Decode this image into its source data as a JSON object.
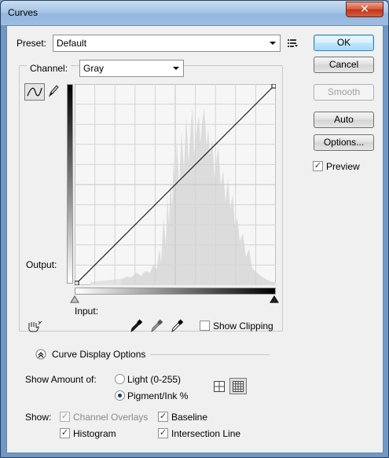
{
  "window": {
    "title": "Curves",
    "close_glyph": "✕"
  },
  "preset": {
    "label": "Preset:",
    "value": "Default",
    "menu_icon": "preset-options-icon"
  },
  "channel": {
    "label": "Channel:",
    "value": "Gray"
  },
  "graph": {
    "output_label": "Output:",
    "input_label": "Input:",
    "curve_tool_icon": "curve-point-icon",
    "pencil_tool_icon": "pencil-icon"
  },
  "buttons": {
    "ok": "OK",
    "cancel": "Cancel",
    "smooth": "Smooth",
    "auto": "Auto",
    "options": "Options..."
  },
  "preview": {
    "label": "Preview",
    "checked": true
  },
  "show_clipping": {
    "label": "Show Clipping",
    "checked": false
  },
  "curve_display_options": {
    "label": "Curve Display Options"
  },
  "show_amount": {
    "label": "Show Amount of:",
    "options": [
      {
        "label": "Light  (0-255)",
        "selected": false
      },
      {
        "label": "Pigment/Ink %",
        "selected": true
      }
    ]
  },
  "show": {
    "label": "Show:",
    "channel_overlays": {
      "label": "Channel Overlays",
      "checked": true,
      "disabled": true
    },
    "baseline": {
      "label": "Baseline",
      "checked": true
    },
    "histogram": {
      "label": "Histogram",
      "checked": true
    },
    "intersection_line": {
      "label": "Intersection Line",
      "checked": true
    }
  },
  "colors": {
    "title_bar": "#a8c6e6",
    "dialog_bg": "#f0f0f0",
    "histogram": "#dcdcdc",
    "grid": "#d8d8d8",
    "close_button": "#d5583a"
  }
}
